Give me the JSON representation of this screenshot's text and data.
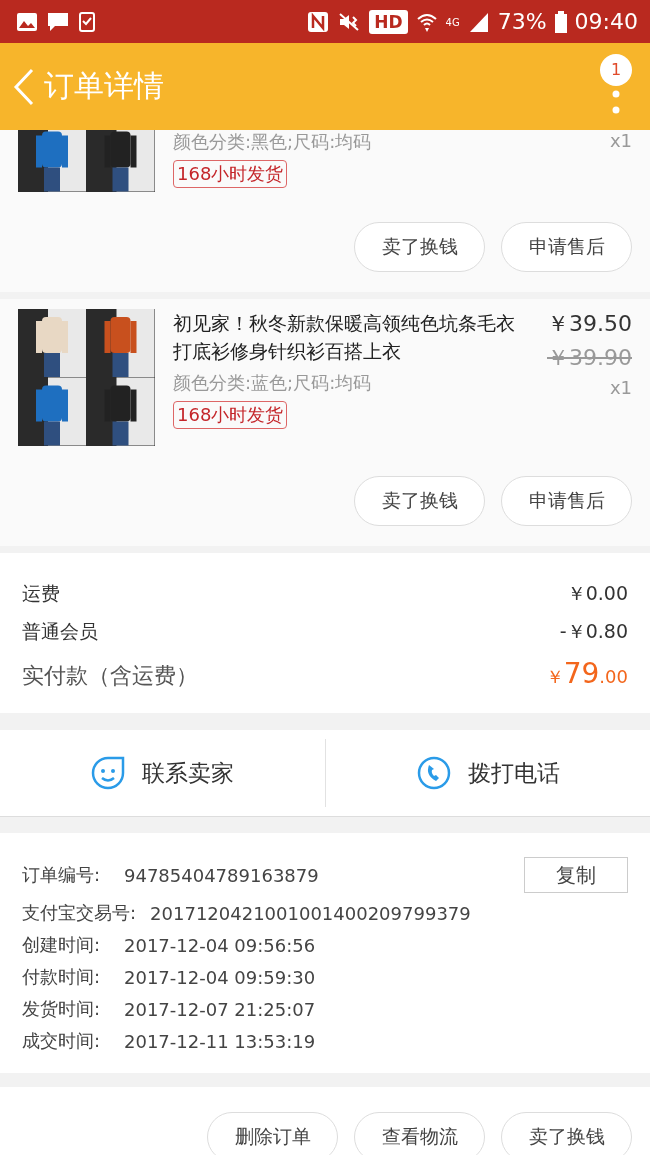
{
  "status_bar": {
    "hd": "HD",
    "network": "4G",
    "battery": "73%",
    "time": "09:40"
  },
  "header": {
    "title": "订单详情",
    "badge": "1"
  },
  "items": [
    {
      "spec": "颜色分类:黑色;尺码:均码",
      "quantity": "x1",
      "tag": "168小时发货",
      "buttons": [
        "卖了换钱",
        "申请售后"
      ]
    },
    {
      "title": "初见家！秋冬新款保暖高领纯色坑条毛衣打底衫修身针织衫百搭上衣",
      "price": "￥39.50",
      "original_price": "￥39.90",
      "spec": "颜色分类:蓝色;尺码:均码",
      "quantity": "x1",
      "tag": "168小时发货",
      "buttons": [
        "卖了换钱",
        "申请售后"
      ]
    }
  ],
  "fees": [
    {
      "label": "运费",
      "value": "￥0.00"
    },
    {
      "label": "普通会员",
      "value": "-￥0.80"
    }
  ],
  "total": {
    "label": "实付款（含运费）",
    "currency": "￥",
    "amount": "79",
    "cents": ".00"
  },
  "contact": [
    {
      "kind": "chat",
      "label": "联系卖家"
    },
    {
      "kind": "phone",
      "label": "拨打电话"
    }
  ],
  "info": [
    {
      "label": "订单编号:",
      "value": "94785404789163879"
    },
    {
      "label": "支付宝交易号:",
      "value": "2017120421001001400209799379"
    },
    {
      "label": "创建时间:",
      "value": "2017-12-04 09:56:56"
    },
    {
      "label": "付款时间:",
      "value": "2017-12-04 09:59:30"
    },
    {
      "label": "发货时间:",
      "value": "2017-12-07 21:25:07"
    },
    {
      "label": "成交时间:",
      "value": "2017-12-11 13:53:19"
    }
  ],
  "copy_button": "复制",
  "actions": [
    "删除订单",
    "查看物流",
    "卖了换钱"
  ]
}
